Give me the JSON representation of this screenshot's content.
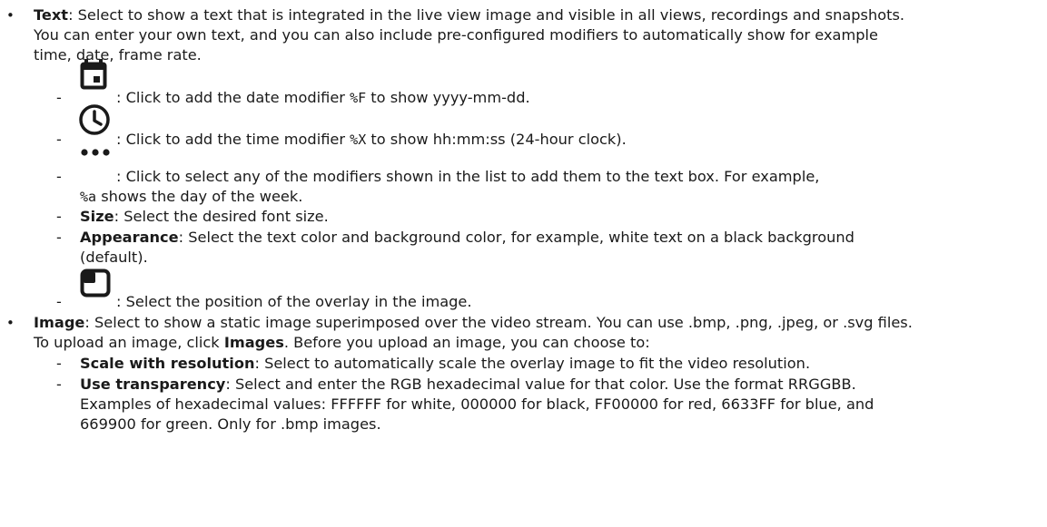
{
  "text_item": {
    "bullet": "•",
    "term": "Text",
    "line1": ": Select to show a text that is integrated in the live view image and visible in all views, recordings and snapshots.",
    "line2": "You can enter your own text, and you can also include pre-configured modifiers to automatically show for example",
    "line3": "time, date, frame rate.",
    "date": {
      "icon": "calendar-icon",
      "pre": ": Click to add the date modifier ",
      "code": "%F",
      "post": " to show yyyy-mm-dd."
    },
    "time": {
      "icon": "clock-icon",
      "pre": ": Click to add the time modifier ",
      "code": "%X",
      "post": " to show hh:mm:ss (24-hour clock)."
    },
    "more": {
      "icon": "ellipsis-icon",
      "line1": ": Click to select any of the modifiers shown in the list to add them to the text box. For example,",
      "code": "%a",
      "line2": " shows the day of the week."
    },
    "size": {
      "term": "Size",
      "text": ": Select the desired font size."
    },
    "appearance": {
      "term": "Appearance",
      "line1": ": Select the text color and background color, for example, white text on a black background",
      "line2": "(default)."
    },
    "position": {
      "icon": "position-icon",
      "text": ": Select the position of the overlay in the image."
    }
  },
  "image_item": {
    "bullet": "•",
    "term": "Image",
    "line1": ": Select to show a static image superimposed over the video stream. You can use .bmp, .png, .jpeg, or .svg files.",
    "line2_pre": "To upload an image, click ",
    "line2_term": "Images",
    "line2_post": ". Before you upload an image, you can choose to:",
    "scale": {
      "term": "Scale with resolution",
      "text": ": Select to automatically scale the overlay image to fit the video resolution."
    },
    "transparency": {
      "term": "Use transparency",
      "line1": ": Select and enter the RGB hexadecimal value for that color. Use the format RRGGBB.",
      "line2": "Examples of hexadecimal values: FFFFFF for white, 000000 for black, FF00000 for red, 6633FF for blue, and",
      "line3": "669900 for green. Only for .bmp images."
    }
  },
  "dash": "-"
}
